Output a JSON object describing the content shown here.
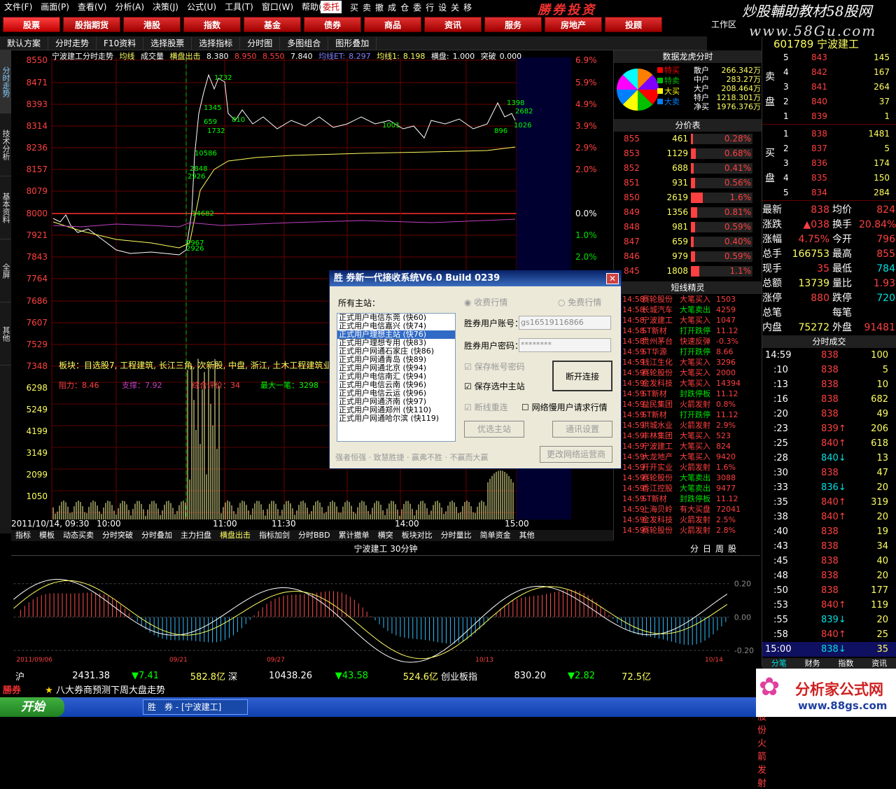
{
  "menu": [
    "文件(F)",
    "画面(P)",
    "查看(V)",
    "分析(A)",
    "决策(J)",
    "公式(U)",
    "工具(T)",
    "窗口(W)",
    "帮助(H)"
  ],
  "toolbar": {
    "weituo": "委托",
    "items": [
      "买",
      "卖",
      "撤",
      "成",
      "仓",
      "委",
      "行",
      "设",
      "关",
      "移"
    ],
    "brand": "勝券投资"
  },
  "watermark": {
    "top": "炒股輔助教材58股网",
    "url": "www.58Gu.com"
  },
  "nav": [
    "股票",
    "股指期货",
    "港股",
    "指数",
    "基金",
    "债券",
    "商品",
    "资讯",
    "服务",
    "房地产",
    "投顾"
  ],
  "workarea": "工作区",
  "subbar": [
    "默认方案",
    "分时走势",
    "F10资料",
    "选择股票",
    "选择指标",
    "分时图",
    "多图组合",
    "图形叠加"
  ],
  "sidetabs": [
    "分时走势",
    "技术分析",
    "基本资料",
    "全屏",
    "其他"
  ],
  "infoline": {
    "title": "宁波建工分时走势",
    "junxian": "均线",
    "chengjiao": "成交量",
    "hengpan": "横盘出击",
    "v1": "8.380",
    "v2": "8.950",
    "v3": "8.550",
    "v4": "7.840",
    "jx_label": "均线ET:",
    "jx_val": "8.297",
    "jxl_label": "均线1:",
    "jxl_val": "8.198",
    "hp_label": "横盘:",
    "hp_val": "1.000",
    "tp_label": "突破",
    "tp_val": "0.000"
  },
  "price_axis": [
    "8550",
    "8471",
    "8393",
    "8314",
    "8236",
    "8157",
    "8079",
    "8000",
    "7921",
    "7843",
    "7764",
    "7686",
    "7607",
    "7529",
    "7348"
  ],
  "pct_axis": [
    "6.9%",
    "5.9%",
    "4.9%",
    "3.9%",
    "2.9%",
    "2.0%",
    "0.0%",
    "1.0%",
    "2.0%"
  ],
  "vol_axis": [
    "6298",
    "5249",
    "4199",
    "3149",
    "2099",
    "1050"
  ],
  "annotations": {
    "sector": "板块：目选股7, 工程建筑, 长江三角, 次新股, 中盘, 浙江, 土木工程建筑业",
    "resist": "阻力：8.46",
    "support": "支撑：7.92",
    "composite": "综合评价：34",
    "maxtrade": "最大一笔：3298"
  },
  "chart_labels": [
    "1732",
    "1345",
    "659",
    "1732",
    "810",
    "1001",
    "1398",
    "2682",
    "896",
    "1026",
    "10586",
    "2848",
    "2926",
    "14682",
    "2967",
    "2926"
  ],
  "time_axis": [
    "2011/10/14, 09:30",
    "10:00",
    "11:00",
    "11:30",
    "14:00",
    "15:00"
  ],
  "bottomtabs": [
    "指标",
    "模板",
    "动态买卖",
    "分时突破",
    "分时叠加",
    "主力扫盘",
    "横盘出击",
    "指标加剑",
    "分时BBD",
    "累计撤单",
    "横突",
    "板块对比",
    "分时量比",
    "简单资金",
    "其他"
  ],
  "lower": {
    "title": "宁波建工 30分钟",
    "tabs": [
      "分",
      "日",
      "周",
      "股"
    ],
    "axis": [
      "0.20",
      "0.00",
      "-0.20"
    ],
    "xlabels": [
      "2011/09/06",
      "09/21",
      "09/27",
      "10/13",
      "10/14"
    ]
  },
  "dragon": {
    "title": "数据龙虎分时",
    "labels": [
      "特买",
      "特卖",
      "大买",
      "大卖"
    ],
    "rows": [
      [
        "散户",
        "266.342万"
      ],
      [
        "中户",
        "283.27万"
      ],
      [
        "大户",
        "208.464万"
      ],
      [
        "特户",
        "1218.301万"
      ],
      [
        "净买",
        "1976.376万"
      ]
    ]
  },
  "pricetable": {
    "title": "分价表",
    "rows": [
      [
        "855",
        "461",
        "0.28%"
      ],
      [
        "853",
        "1129",
        "0.68%"
      ],
      [
        "852",
        "688",
        "0.41%"
      ],
      [
        "851",
        "931",
        "0.56%"
      ],
      [
        "850",
        "2619",
        "1.6%"
      ],
      [
        "849",
        "1356",
        "0.81%"
      ],
      [
        "848",
        "981",
        "0.59%"
      ],
      [
        "847",
        "659",
        "0.40%"
      ],
      [
        "846",
        "979",
        "0.59%"
      ],
      [
        "845",
        "1808",
        "1.1%"
      ]
    ]
  },
  "sprite": {
    "title": "短线精灵",
    "rows": [
      [
        "14:58",
        "赛轮股份",
        "大笔买入",
        "1503"
      ],
      [
        "14:58",
        "长城汽车",
        "大笔卖出",
        "4259"
      ],
      [
        "14:58",
        "宁波建工",
        "大笔买入",
        "1047"
      ],
      [
        "14:58",
        "ST新材",
        "打开跌停",
        "11.12"
      ],
      [
        "14:58",
        "贵州茅台",
        "快速反弹",
        "-0.3%"
      ],
      [
        "14:59",
        "ST华源",
        "打开跌停",
        "8.66"
      ],
      [
        "14:59",
        "钱江生化",
        "大笔买入",
        "3296"
      ],
      [
        "14:59",
        "赛轮股份",
        "大笔买入",
        "2000"
      ],
      [
        "14:59",
        "金发科技",
        "大笔买入",
        "14394"
      ],
      [
        "14:59",
        "ST新材",
        "封跌停板",
        "11.12"
      ],
      [
        "14:59",
        "益民集团",
        "火箭发射",
        "0.8%"
      ],
      [
        "14:59",
        "ST新材",
        "打开跌停",
        "11.12"
      ],
      [
        "14:59",
        "洪城水业",
        "火箭发射",
        "2.9%"
      ],
      [
        "14:59",
        "丰林集团",
        "大笔买入",
        "523"
      ],
      [
        "14:59",
        "宁波建工",
        "大笔买入",
        "824"
      ],
      [
        "14:59",
        "大龙地产",
        "大笔买入",
        "9420"
      ],
      [
        "14:59",
        "开开实业",
        "火箭发射",
        "1.6%"
      ],
      [
        "14:59",
        "赛轮股份",
        "大笔卖出",
        "3088"
      ],
      [
        "14:59",
        "香江控股",
        "大笔卖出",
        "9477"
      ],
      [
        "14:59",
        "ST新材",
        "封跌停板",
        "11.12"
      ],
      [
        "14:59",
        "上海贝岭",
        "有大买盘",
        "72041"
      ],
      [
        "14:59",
        "金发科技",
        "火箭发射",
        "2.5%"
      ],
      [
        "14:59",
        "赛轮股份",
        "火箭发射",
        "2.8%"
      ]
    ]
  },
  "quote": {
    "code": "601789",
    "name": "宁波建工",
    "sell": [
      [
        "5",
        "843",
        "145"
      ],
      [
        "4",
        "842",
        "167"
      ],
      [
        "3",
        "841",
        "264"
      ],
      [
        "2",
        "840",
        "37"
      ],
      [
        "1",
        "839",
        "1"
      ]
    ],
    "buy": [
      [
        "1",
        "838",
        "1481"
      ],
      [
        "2",
        "837",
        "5"
      ],
      [
        "3",
        "836",
        "174"
      ],
      [
        "4",
        "835",
        "150"
      ],
      [
        "5",
        "834",
        "284"
      ]
    ],
    "sell_label": "卖盘",
    "buy_label": "买盘"
  },
  "stats": [
    [
      "最新",
      "838",
      "均价",
      "824"
    ],
    [
      "涨跌",
      "▲038",
      "换手",
      "20.84%"
    ],
    [
      "涨幅",
      "4.75%",
      "今开",
      "796"
    ],
    [
      "总手",
      "166753",
      "最高",
      "855"
    ],
    [
      "现手",
      "35",
      "最低",
      "784"
    ],
    [
      "总额",
      "13739",
      "量比",
      "1.93"
    ],
    [
      "涨停",
      "880",
      "跌停",
      "720"
    ],
    [
      "总笔",
      "",
      "每笔",
      ""
    ],
    [
      "内盘",
      "75272",
      "外盘",
      "91481"
    ]
  ],
  "trades": {
    "title": "分时成交",
    "rows": [
      [
        "14:59",
        "838",
        "100"
      ],
      [
        ":10",
        "838",
        "5"
      ],
      [
        ":13",
        "838",
        "10"
      ],
      [
        ":16",
        "838",
        "682"
      ],
      [
        ":20",
        "838",
        "49"
      ],
      [
        ":23",
        "839↑",
        "206"
      ],
      [
        ":25",
        "840↑",
        "618"
      ],
      [
        ":28",
        "840↓",
        "13"
      ],
      [
        ":30",
        "838",
        "47"
      ],
      [
        ":33",
        "836↓",
        "20"
      ],
      [
        ":35",
        "840↑",
        "319"
      ],
      [
        ":38",
        "840↑",
        "20"
      ],
      [
        ":40",
        "838",
        "19"
      ],
      [
        ":43",
        "838",
        "34"
      ],
      [
        ":45",
        "838",
        "40"
      ],
      [
        ":48",
        "838",
        "20"
      ],
      [
        ":50",
        "838",
        "177"
      ],
      [
        ":53",
        "840↑",
        "119"
      ],
      [
        ":55",
        "839↓",
        "20"
      ],
      [
        ":58",
        "840↑",
        "25"
      ],
      [
        "15:00",
        "838↓",
        "35"
      ]
    ],
    "tabs": [
      "分笔",
      "财务",
      "指数",
      "资讯"
    ]
  },
  "status": {
    "sh": "沪",
    "sh_idx": "2431.38",
    "sh_chg": "▼7.41",
    "sh_amt": "582.8亿",
    "sz": "深",
    "sz_idx": "10438.26",
    "sz_chg": "▼43.58",
    "sz_amt": "524.6亿",
    "cy": "创业板指",
    "cy_idx": "830.20",
    "cy_chg": "▼2.82",
    "cy_amt": "72.5亿"
  },
  "ticker": {
    "brand": "勝券",
    "text": "八大券商预测下周大盘走势",
    "right": "赛轮股份 火箭发射"
  },
  "taskbar": {
    "start": "开始",
    "item": "胜　券 - [宁波建工]"
  },
  "logo2": {
    "name": "分析家公式网",
    "url": "www.88gs.com"
  },
  "dialog": {
    "title": "胜 券新一代接收系统V6.0 Build 0239",
    "all_servers": "所有主站：",
    "fee": "收费行情",
    "free": "免费行情",
    "acct_label": "胜券用户账号：",
    "acct_val": "gs16519116866",
    "pwd_label": "胜券用户密码：",
    "pwd_val": "********",
    "save_acct": "保存帐号密码",
    "save_server": "保存选中主站",
    "disconnect": "断开连接",
    "reconnect": "断线重连",
    "net_slow": "网络慢用户请求行情",
    "pick_server": "优选主站",
    "comm_set": "通讯设置",
    "change_net": "更改网络运营商",
    "slogan": "强者恒强 · 致慧胜捷 · 赢弗不胜 · 不赢而大赢",
    "servers": [
      "正式用户电信东莞 (快60)",
      "正式用户电信嘉兴 (快74)",
      "正式用户理想主站 (快76)",
      "正式用户理想专用 (快83)",
      "正式用户网通石家庄 (快86)",
      "正式用户网通青岛 (快89)",
      "正式用户网通北京 (快94)",
      "正式用户电信南汇 (快94)",
      "正式用户电信云南 (快96)",
      "正式用户电信云运 (快96)",
      "正式用户网通济南 (快97)",
      "正式用户网通郑州 (快110)",
      "正式用户网通哈尔滨 (快119)"
    ]
  },
  "colors": {
    "up": "#ff3030",
    "down": "#00e0e0",
    "price_line": "#ffffff",
    "avg_line": "#ffff60",
    "grid": "#8b0000",
    "vol": "#ffffa0"
  }
}
